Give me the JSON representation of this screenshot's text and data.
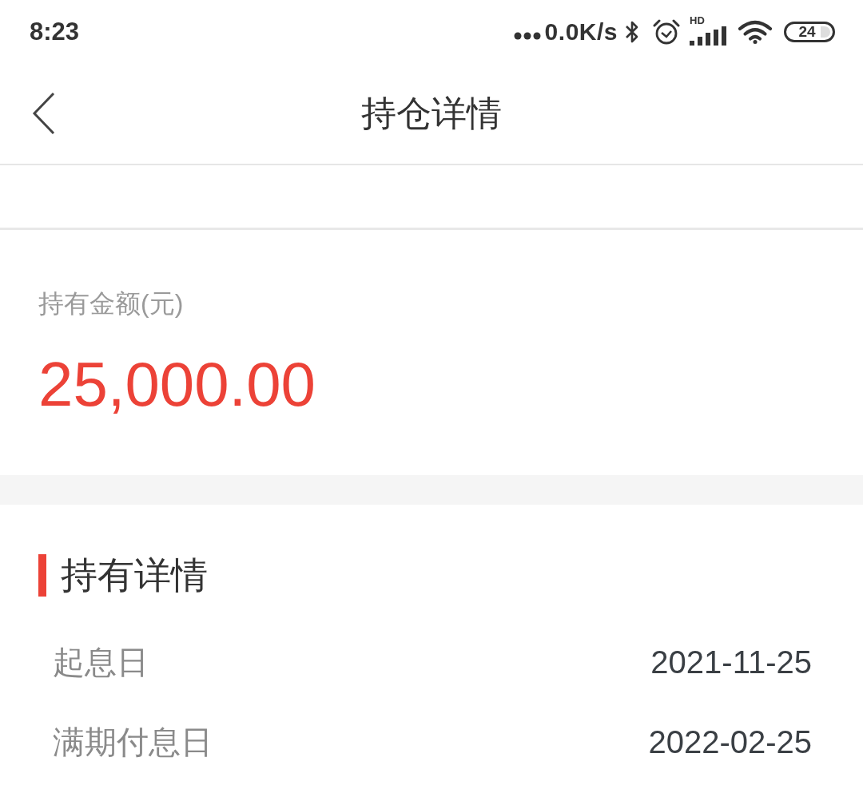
{
  "status_bar": {
    "time": "8:23",
    "net_speed": "0.0K/s",
    "signal_label": "HD",
    "battery": "24"
  },
  "nav": {
    "title": "持仓详情"
  },
  "holding": {
    "label": "持有金额(元)",
    "amount": "25,000.00"
  },
  "details": {
    "heading": "持有详情",
    "rows": [
      {
        "label": "起息日",
        "value": "2021-11-25"
      },
      {
        "label": "满期付息日",
        "value": "2022-02-25"
      }
    ]
  }
}
